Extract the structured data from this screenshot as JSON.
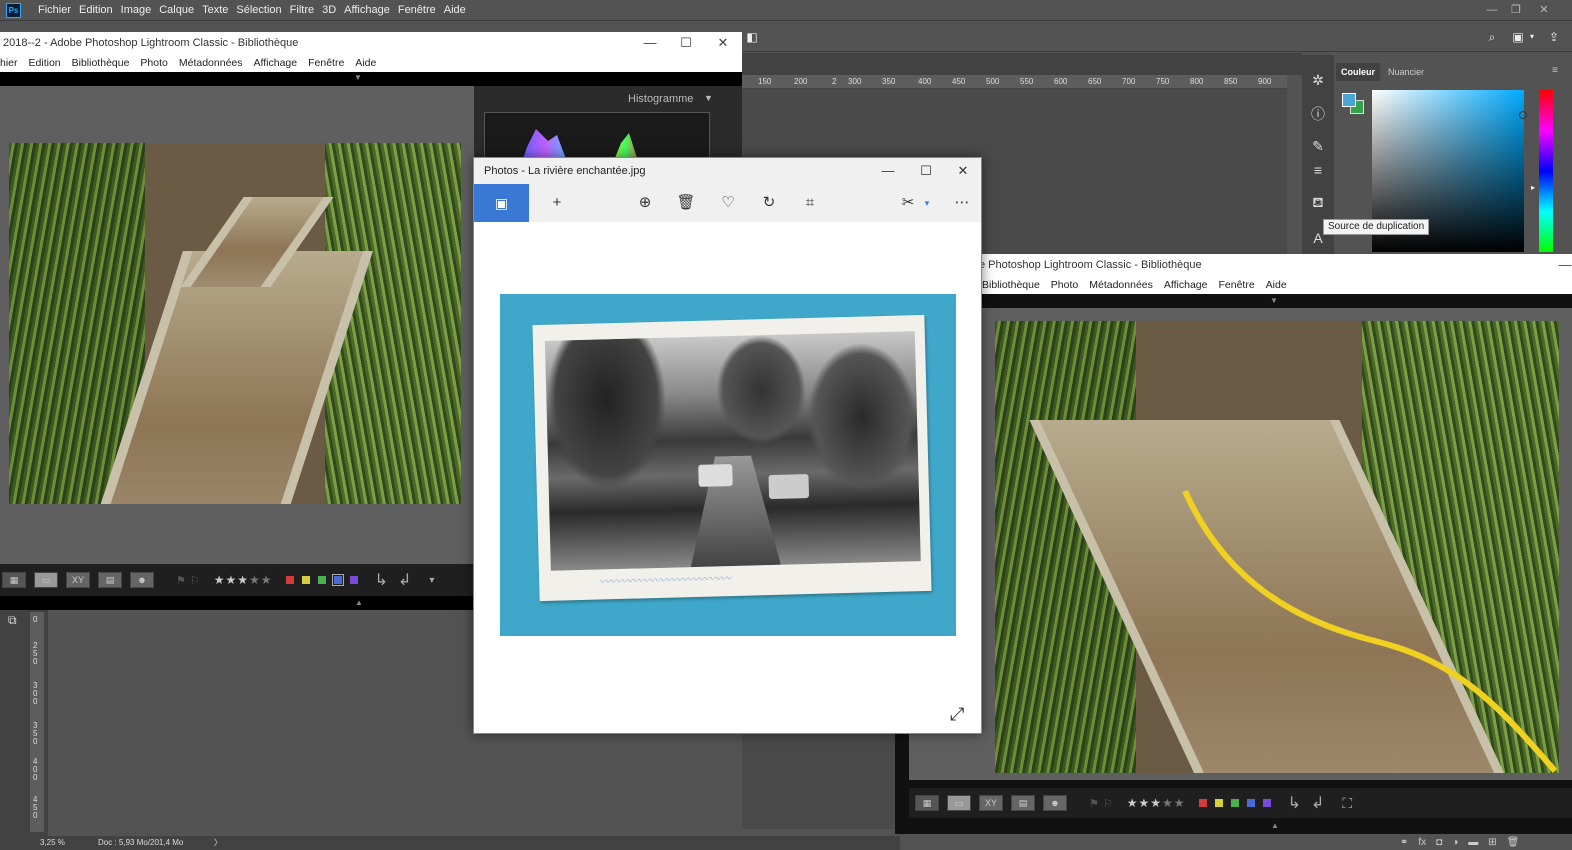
{
  "photoshop": {
    "logo": "Ps",
    "menu": [
      "Fichier",
      "Edition",
      "Image",
      "Calque",
      "Texte",
      "Sélection",
      "Filtre",
      "3D",
      "Affichage",
      "Fenêtre",
      "Aide"
    ],
    "window_controls": {
      "minimize": "—",
      "restore": "❐",
      "close": "✕"
    },
    "ruler_ticks": [
      "150",
      "200",
      "2",
      "300",
      "350",
      "400",
      "450",
      "500",
      "550",
      "600",
      "650",
      "700",
      "750",
      "800",
      "850",
      "900"
    ],
    "vruler_ticks": [
      "0",
      "250",
      "300",
      "350",
      "400",
      "450"
    ],
    "color_panel": {
      "tab_color": "Couleur",
      "tab_swatches": "Nuancier",
      "fg_color": "#4ba3d6",
      "bg_color": "#35a34a"
    },
    "tooltip": "Source de duplication",
    "status": {
      "zoom": "3,25 %",
      "doc": "Doc : 5,93 Mo/201,4 Mo",
      "arrow": "〉"
    }
  },
  "lightroom_left": {
    "title": "2018--2 - Adobe Photoshop Lightroom Classic - Bibliothèque",
    "menu": [
      "hier",
      "Edition",
      "Bibliothèque",
      "Photo",
      "Métadonnées",
      "Affichage",
      "Fenêtre",
      "Aide"
    ],
    "panel_title": "Histogramme",
    "toolbar": {
      "xy": "XY",
      "stars_on": "★★★",
      "stars_off": "★★"
    },
    "label_colors": [
      "#d43b3b",
      "#d8d03a",
      "#4caf50",
      "#4a6ad8",
      "#7a4ad8"
    ]
  },
  "lightroom_right": {
    "title": "e Photoshop Lightroom Classic - Bibliothèque",
    "menu": [
      "Bibliothèque",
      "Photo",
      "Métadonnées",
      "Affichage",
      "Fenêtre",
      "Aide"
    ],
    "toolbar": {
      "xy": "XY",
      "stars_on": "★★★",
      "stars_off": "★★"
    },
    "label_colors": [
      "#d43b3b",
      "#d8d03a",
      "#4caf50",
      "#4a6ad8",
      "#7a4ad8"
    ]
  },
  "photos_app": {
    "title": "Photos - La rivière enchantée.jpg",
    "window_controls": {
      "minimize": "—",
      "maximize": "☐",
      "close": "✕"
    },
    "toolbar_icons": [
      "add-icon",
      "zoom-icon",
      "delete-icon",
      "favorite-icon",
      "rotate-icon",
      "crop-icon",
      "edit-icon",
      "more-icon"
    ]
  }
}
